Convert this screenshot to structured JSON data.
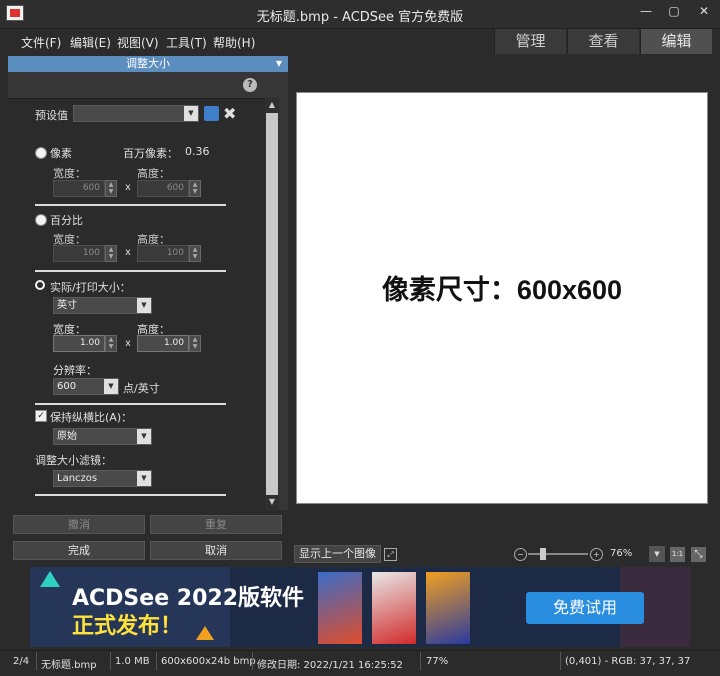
{
  "window": {
    "title": "无标题.bmp - ACDSee 官方免费版",
    "min": "—",
    "max": "▢",
    "close": "✕"
  },
  "menu": {
    "items": [
      "文件(F)",
      "编辑(E)",
      "视图(V)",
      "工具(T)",
      "帮助(H)"
    ],
    "modes": [
      "管理",
      "查看",
      "编辑"
    ]
  },
  "panel": {
    "title": "调整大小",
    "preset_label": "预设值",
    "preset_value": "",
    "pixels": {
      "label": "像素",
      "megapixel_label": "百万像素：",
      "megapixel_value": "0.36",
      "width_label": "宽度：",
      "height_label": "高度：",
      "width": "600",
      "height": "600"
    },
    "percent": {
      "label": "百分比",
      "width_label": "宽度：",
      "height_label": "高度：",
      "width": "100",
      "height": "100"
    },
    "print": {
      "label": "实际/打印大小：",
      "unit": "英寸",
      "width_label": "宽度：",
      "height_label": "高度：",
      "width": "1.00",
      "height": "1.00",
      "resolution_label": "分辨率：",
      "resolution": "600",
      "resolution_unit": "点/英寸"
    },
    "x": "x",
    "keep_aspect_label": "保持纵横比(A)：",
    "keep_aspect_checked": true,
    "aspect_value": "原始",
    "filter_label": "调整大小滤镜：",
    "filter_value": "Lanczos",
    "buttons": {
      "cancel": "撤消",
      "redo": "重复",
      "done": "完成",
      "abort": "取消"
    },
    "help": "?"
  },
  "preview": {
    "text": "像素尺寸：600x600",
    "show_prev": "显示上一个图像",
    "zoom": "76%",
    "one_to_one": "1:1"
  },
  "ad": {
    "title": "ACDSee 2022版软件",
    "subtitle": "正式发布！",
    "button": "免费试用"
  },
  "status": {
    "index": "2/4",
    "filename": "无标题.bmp",
    "size": "1.0 MB",
    "dims": "600x600x24b bmp",
    "modified": "修改日期: 2022/1/21 16:25:52",
    "zoom": "77%",
    "pixel_info": "(0,401) - RGB: 37, 37, 37"
  },
  "colors": {
    "panel_header": "#5b8dbf",
    "ad_button": "#2a8ee0",
    "ad_highlight": "#ffe23a"
  }
}
